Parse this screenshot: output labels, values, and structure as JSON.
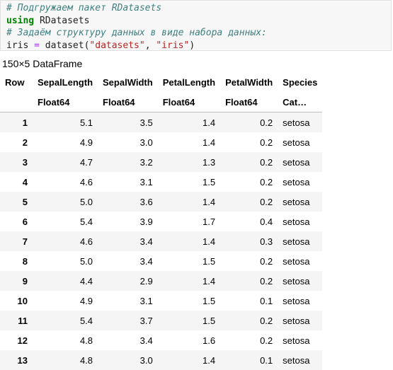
{
  "code_cell": {
    "line1": "# Подгружаем пакет RDatasets",
    "line2_kw": "using",
    "line2_rest": " RDatasets",
    "line3": "# Задаём структуру данных в виде набора данных:",
    "line4_var": "iris ",
    "line4_op": "=",
    "line4_fn": " dataset(",
    "line4_arg1": "\"datasets\"",
    "line4_sep": ", ",
    "line4_arg2": "\"iris\"",
    "line4_end": ")"
  },
  "output": {
    "summary": "150×5 DataFrame",
    "columns": [
      "Row",
      "SepalLength",
      "SepalWidth",
      "PetalLength",
      "PetalWidth",
      "Species"
    ],
    "types": [
      "",
      "Float64",
      "Float64",
      "Float64",
      "Float64",
      "Cat…"
    ],
    "rows": [
      [
        "1",
        "5.1",
        "3.5",
        "1.4",
        "0.2",
        "setosa"
      ],
      [
        "2",
        "4.9",
        "3.0",
        "1.4",
        "0.2",
        "setosa"
      ],
      [
        "3",
        "4.7",
        "3.2",
        "1.3",
        "0.2",
        "setosa"
      ],
      [
        "4",
        "4.6",
        "3.1",
        "1.5",
        "0.2",
        "setosa"
      ],
      [
        "5",
        "5.0",
        "3.6",
        "1.4",
        "0.2",
        "setosa"
      ],
      [
        "6",
        "5.4",
        "3.9",
        "1.7",
        "0.4",
        "setosa"
      ],
      [
        "7",
        "4.6",
        "3.4",
        "1.4",
        "0.3",
        "setosa"
      ],
      [
        "8",
        "5.0",
        "3.4",
        "1.5",
        "0.2",
        "setosa"
      ],
      [
        "9",
        "4.4",
        "2.9",
        "1.4",
        "0.2",
        "setosa"
      ],
      [
        "10",
        "4.9",
        "3.1",
        "1.5",
        "0.1",
        "setosa"
      ],
      [
        "11",
        "5.4",
        "3.7",
        "1.5",
        "0.2",
        "setosa"
      ],
      [
        "12",
        "4.8",
        "3.4",
        "1.6",
        "0.2",
        "setosa"
      ],
      [
        "13",
        "4.8",
        "3.0",
        "1.4",
        "0.1",
        "setosa"
      ]
    ]
  }
}
